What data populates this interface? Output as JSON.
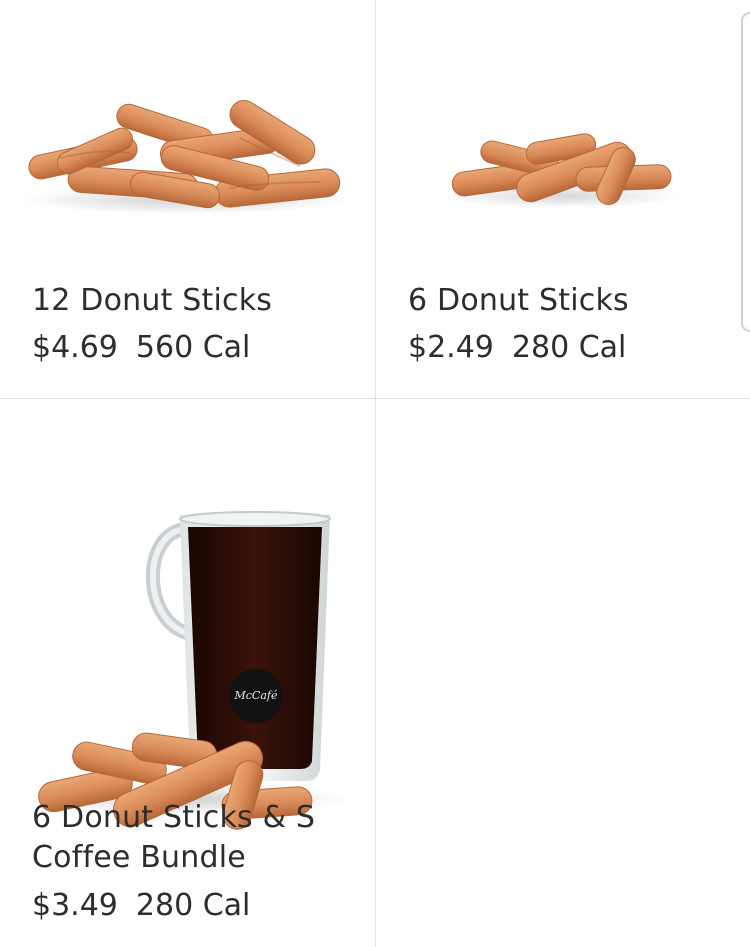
{
  "menu": {
    "items": [
      {
        "name": "12 Donut Sticks",
        "price": "$4.69",
        "calories": "560 Cal",
        "image_icon": "donut-sticks-12-image"
      },
      {
        "name": "6 Donut Sticks",
        "price": "$2.49",
        "calories": "280 Cal",
        "image_icon": "donut-sticks-6-image"
      },
      {
        "name": "6 Donut Sticks & S Coffee Bundle",
        "price": "$3.49",
        "calories": "280 Cal",
        "image_icon": "donut-sticks-coffee-bundle-image",
        "mug_logo": "McCafé"
      }
    ]
  },
  "colors": {
    "donut": "#d98a59",
    "donut_dark": "#b86838",
    "coffee": "#2a0d07",
    "divider": "#e2dbe6"
  }
}
